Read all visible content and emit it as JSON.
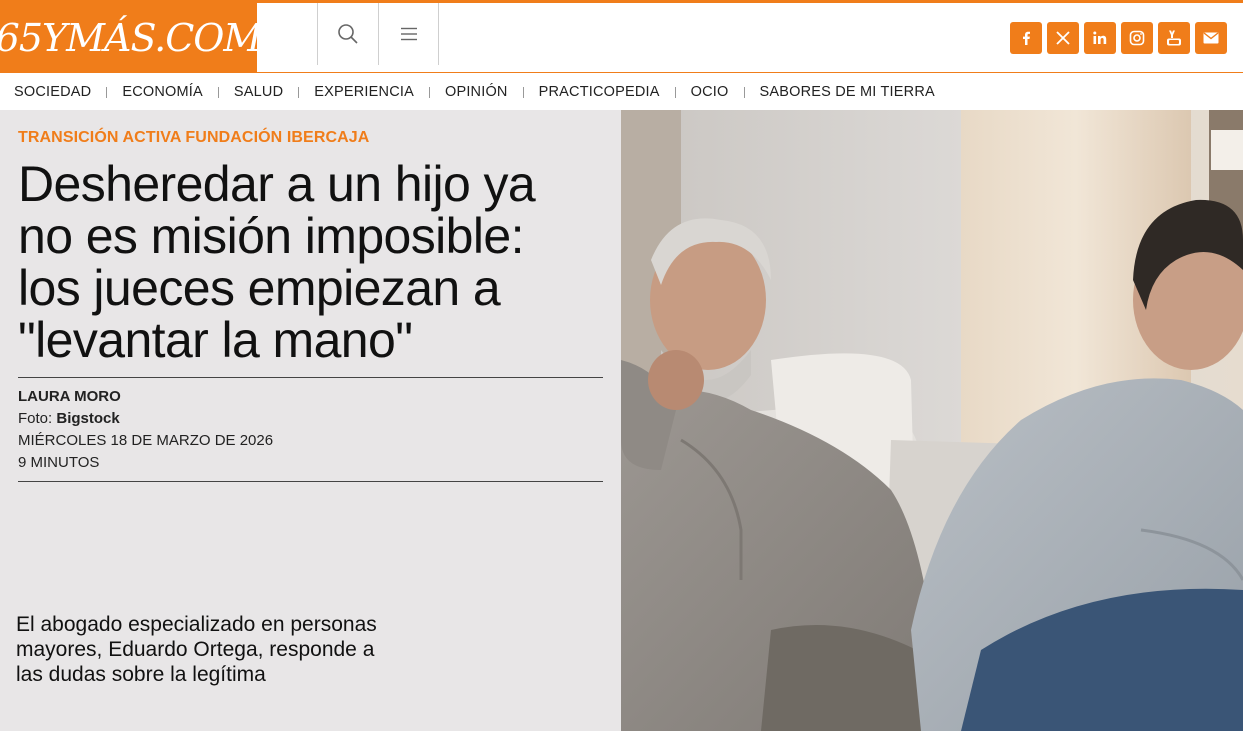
{
  "logo": {
    "text": "65YMÁS.COM"
  },
  "header": {
    "search_icon": "search-icon",
    "menu_icon": "menu-icon"
  },
  "social": [
    {
      "name": "facebook-icon",
      "glyph": "f"
    },
    {
      "name": "x-icon",
      "glyph": "X"
    },
    {
      "name": "linkedin-icon",
      "glyph": "in"
    },
    {
      "name": "instagram-icon",
      "glyph": "ig"
    },
    {
      "name": "youtube-icon",
      "glyph": "You Tube"
    },
    {
      "name": "mail-icon",
      "glyph": "mail"
    }
  ],
  "nav": {
    "items": [
      "SOCIEDAD",
      "ECONOMÍA",
      "SALUD",
      "EXPERIENCIA",
      "OPINIÓN",
      "PRACTICOPEDIA",
      "OCIO",
      "SABORES DE MI TIERRA"
    ]
  },
  "article": {
    "kicker": "TRANSICIÓN ACTIVA FUNDACIÓN IBERCAJA",
    "headline": "Desheredar a un hijo ya no es misión imposible: los jueces empiezan a \"levantar la mano\"",
    "author": "LAURA MORO",
    "photo_label": "Foto: ",
    "photo_credit": "Bigstock",
    "date": "MIÉRCOLES 18 DE MARZO DE 2026",
    "read_time": "9 MINUTOS",
    "summary": "El abogado especializado en personas mayores, Eduardo Ortega, responde a las dudas sobre la legítima"
  },
  "colors": {
    "brand": "#f07d1a",
    "panel": "#e8e6e7"
  }
}
